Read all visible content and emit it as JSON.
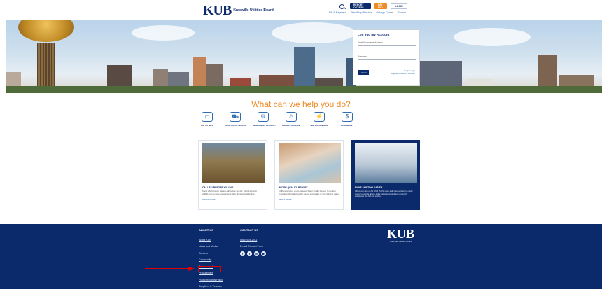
{
  "header": {
    "logo_mark": "KUB",
    "logo_text": "Knoxville Utilities Board",
    "report_label": "REPORT OUTAGE",
    "pay_label": "PAY BILL",
    "login_label": "LOGIN",
    "nav": [
      "Bill & Payment",
      "Start/Stop Service",
      "Outage Center",
      "Search"
    ]
  },
  "login": {
    "title": "Log Into My Account",
    "email_label": "Email/Username Address",
    "password_label": "Password",
    "button": "LOGIN",
    "links": [
      "Forgot Login",
      "Register/Create My Account"
    ]
  },
  "help": {
    "title": "What can we help you do?",
    "services": [
      {
        "icon": "payment-icon",
        "glyph": "▭",
        "label": "PAY MY BILL"
      },
      {
        "icon": "truck-icon",
        "glyph": "⛟",
        "label": "START/STOP SERVICE"
      },
      {
        "icon": "gear-icon",
        "glyph": "⚙",
        "label": "MANAGE MY ACCOUNT"
      },
      {
        "icon": "report-icon",
        "glyph": "⚠",
        "label": "REPORT AN ISSUE"
      },
      {
        "icon": "outage-icon",
        "glyph": "⚡",
        "label": "SEE OUTAGE MAP"
      },
      {
        "icon": "savings-icon",
        "glyph": "$",
        "label": "SAVE MONEY"
      }
    ]
  },
  "cards": [
    {
      "title": "CALL 811 BEFORE YOU DIG",
      "body": "Know what's below. Always call before you dig. Dial 811 or visit call811.com to have underground utility lines marked for free.",
      "link": "LEARN MORE"
    },
    {
      "title": "WATER QUALITY REPORT",
      "body": "KUB encourages you to view our Water Quality Report. It contains important information on the source and quality of your drinking water.",
      "link": "LEARN MORE"
    },
    {
      "title": "MAKE SHIFTING EASIER",
      "body": "When you sign up for KUB PLUS, more daily payment and a credit toward your bills. Every dollar helps local families in need of assistance this fall and spring.",
      "link": ""
    }
  ],
  "footer": {
    "about_title": "ABOUT US",
    "about_links": [
      "About KUB",
      "News and Media",
      "Careers",
      "Community",
      "Environment",
      "Procurement",
      "Public Records Policy",
      "Suppliers & Vendors"
    ],
    "contact_title": "CONTACT US",
    "contact_links": [
      "(865) 524-2911",
      "E-mail Contact Form"
    ],
    "social": [
      "f",
      "t",
      "in",
      "▶"
    ],
    "logo_mark": "KUB",
    "logo_text": "Knoxville Utilities Board"
  },
  "colors": {
    "brand_navy": "#0b2a6b",
    "accent_orange": "#f08a24",
    "link_blue": "#2f6db3",
    "highlight_red": "#e10000"
  }
}
